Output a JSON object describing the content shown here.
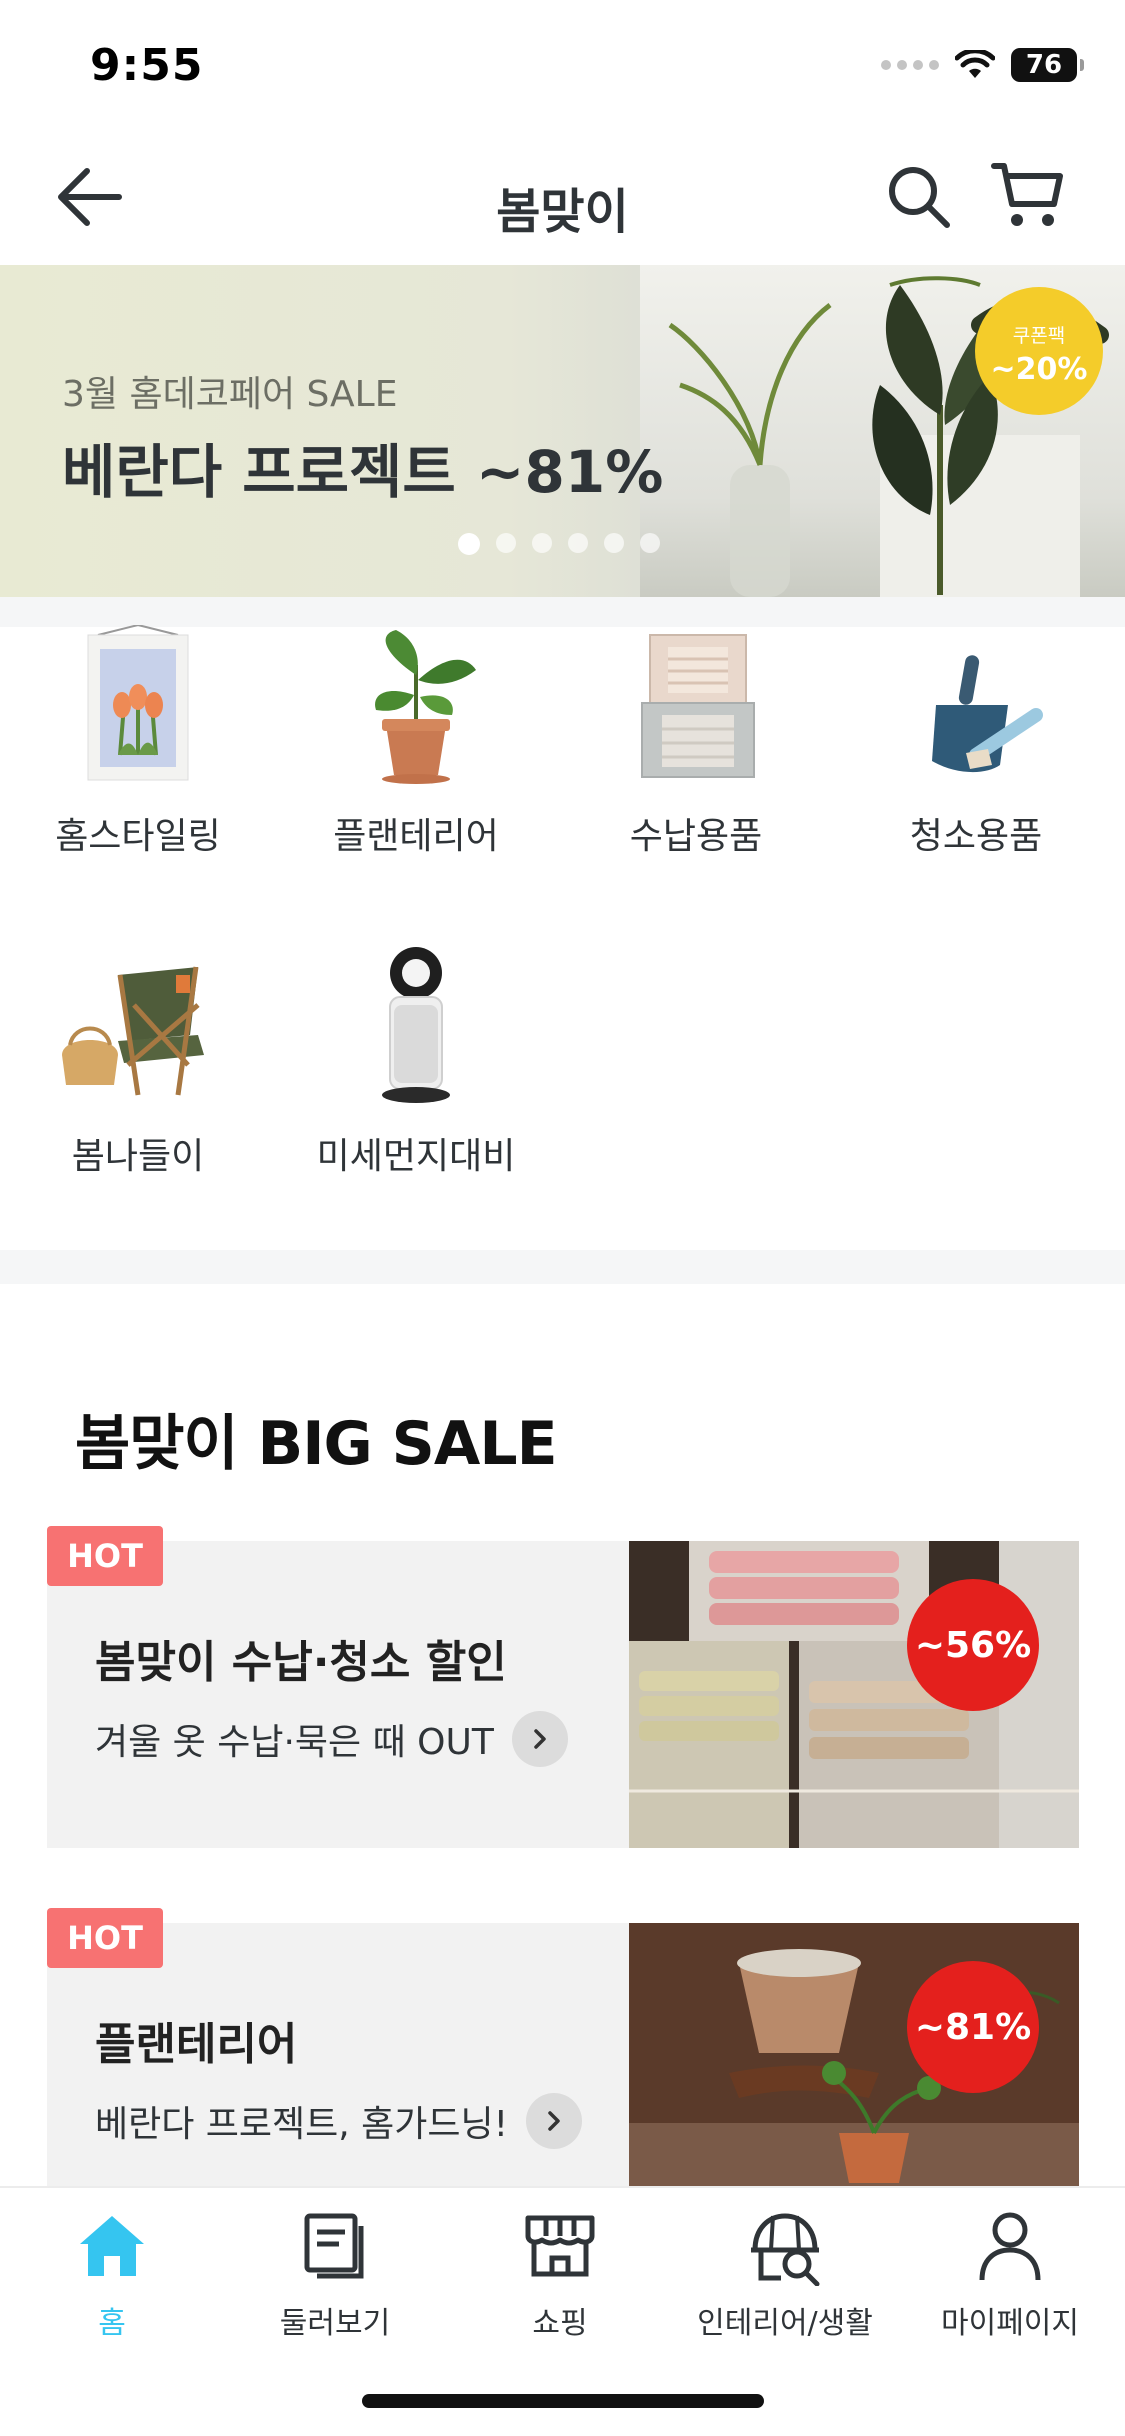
{
  "status_bar": {
    "time": "9:55",
    "battery": "76"
  },
  "header": {
    "title": "봄맞이",
    "icons": [
      "back-arrow-icon",
      "search-icon",
      "cart-icon"
    ]
  },
  "banner": {
    "subtitle": "3월 홈데코페어 SALE",
    "title": "베란다 프로젝트 ~81%",
    "coupon_label": "쿠폰팩",
    "coupon_value": "~20%",
    "slide_count": 6,
    "active_slide": 1
  },
  "categories": [
    {
      "label": "홈스타일링",
      "icon": "wall-tapestry-icon"
    },
    {
      "label": "플랜테리어",
      "icon": "potted-plant-icon"
    },
    {
      "label": "수납용품",
      "icon": "storage-box-icon"
    },
    {
      "label": "청소용품",
      "icon": "dustpan-brush-icon"
    },
    {
      "label": "봄나들이",
      "icon": "camping-chair-icon"
    },
    {
      "label": "미세먼지대비",
      "icon": "air-purifier-icon"
    }
  ],
  "big_sale": {
    "title": "봄맞이 BIG SALE",
    "cards": [
      {
        "badge": "HOT",
        "title": "봄맞이 수납·청소 할인",
        "subtitle": "겨울 옷 수납·묵은 때 OUT",
        "discount": "~56%"
      },
      {
        "badge": "HOT",
        "title": "플랜테리어",
        "subtitle": "베란다 프로젝트, 홈가드닝!",
        "discount": "~81%"
      }
    ]
  },
  "bottom_nav": {
    "items": [
      {
        "label": "홈",
        "icon": "home-icon",
        "active": true
      },
      {
        "label": "둘러보기",
        "icon": "browse-icon",
        "active": false
      },
      {
        "label": "쇼핑",
        "icon": "shop-icon",
        "active": false
      },
      {
        "label": "인테리어/생활",
        "icon": "interior-life-icon",
        "active": false
      },
      {
        "label": "마이페이지",
        "icon": "profile-icon",
        "active": false
      }
    ]
  },
  "colors": {
    "accent": "#35c5f0",
    "hot_badge": "#f77272",
    "discount_badge": "#e4201d",
    "coupon_badge": "#f4cc2a"
  }
}
